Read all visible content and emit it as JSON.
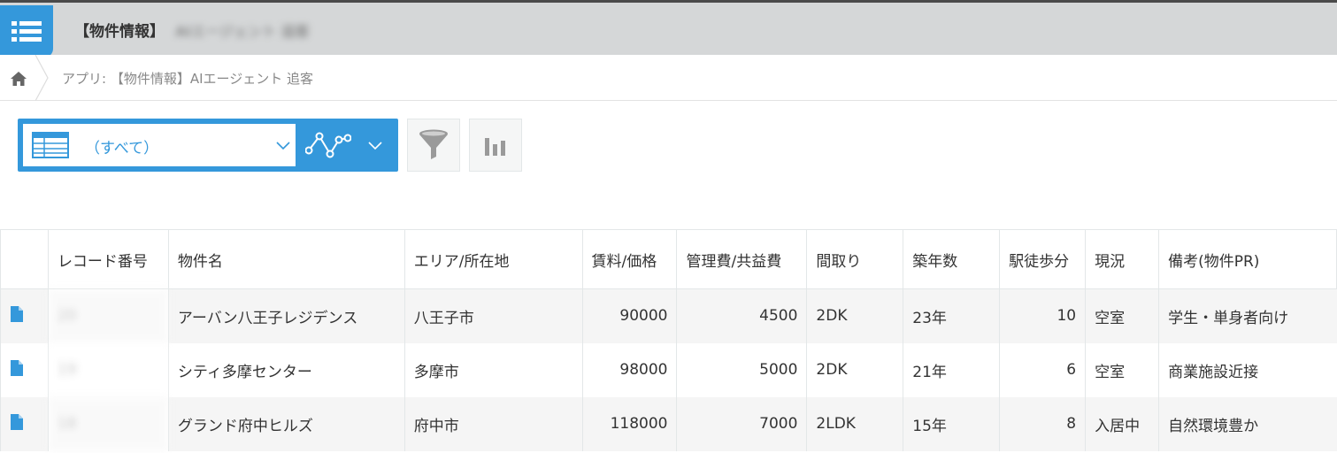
{
  "header": {
    "app_title": "【物件情報】",
    "app_title_redacted": "AIエージェント 追客"
  },
  "breadcrumb": {
    "text": "アプリ: 【物件情報】AIエージェント 追客"
  },
  "toolbar": {
    "view_label": "（すべて）"
  },
  "colors": {
    "accent": "#3498db",
    "topbar": "#d5d7d8",
    "row_alt": "#f5f5f5"
  },
  "icons": [
    "menu-list-icon",
    "home-icon",
    "table-view-icon",
    "chevron-down-icon",
    "line-graph-icon",
    "filter-icon",
    "bar-chart-icon",
    "document-icon"
  ],
  "table": {
    "columns": [
      "",
      "レコード番号",
      "物件名",
      "エリア/所在地",
      "賃料/価格",
      "管理費/共益費",
      "間取り",
      "築年数",
      "駅徒歩分",
      "現況",
      "備考(物件PR)"
    ],
    "rows": [
      {
        "record_no": "20",
        "name": "アーバン八王子レジデンス",
        "area": "八王子市",
        "rent": "90000",
        "fee": "4500",
        "layout": "2DK",
        "age": "23年",
        "walk": "10",
        "status": "空室",
        "note": "学生・単身者向け"
      },
      {
        "record_no": "19",
        "name": "シティ多摩センター",
        "area": "多摩市",
        "rent": "98000",
        "fee": "5000",
        "layout": "2DK",
        "age": "21年",
        "walk": "6",
        "status": "空室",
        "note": "商業施設近接"
      },
      {
        "record_no": "18",
        "name": "グランド府中ヒルズ",
        "area": "府中市",
        "rent": "118000",
        "fee": "7000",
        "layout": "2LDK",
        "age": "15年",
        "walk": "8",
        "status": "入居中",
        "note": "自然環境豊か"
      }
    ]
  }
}
